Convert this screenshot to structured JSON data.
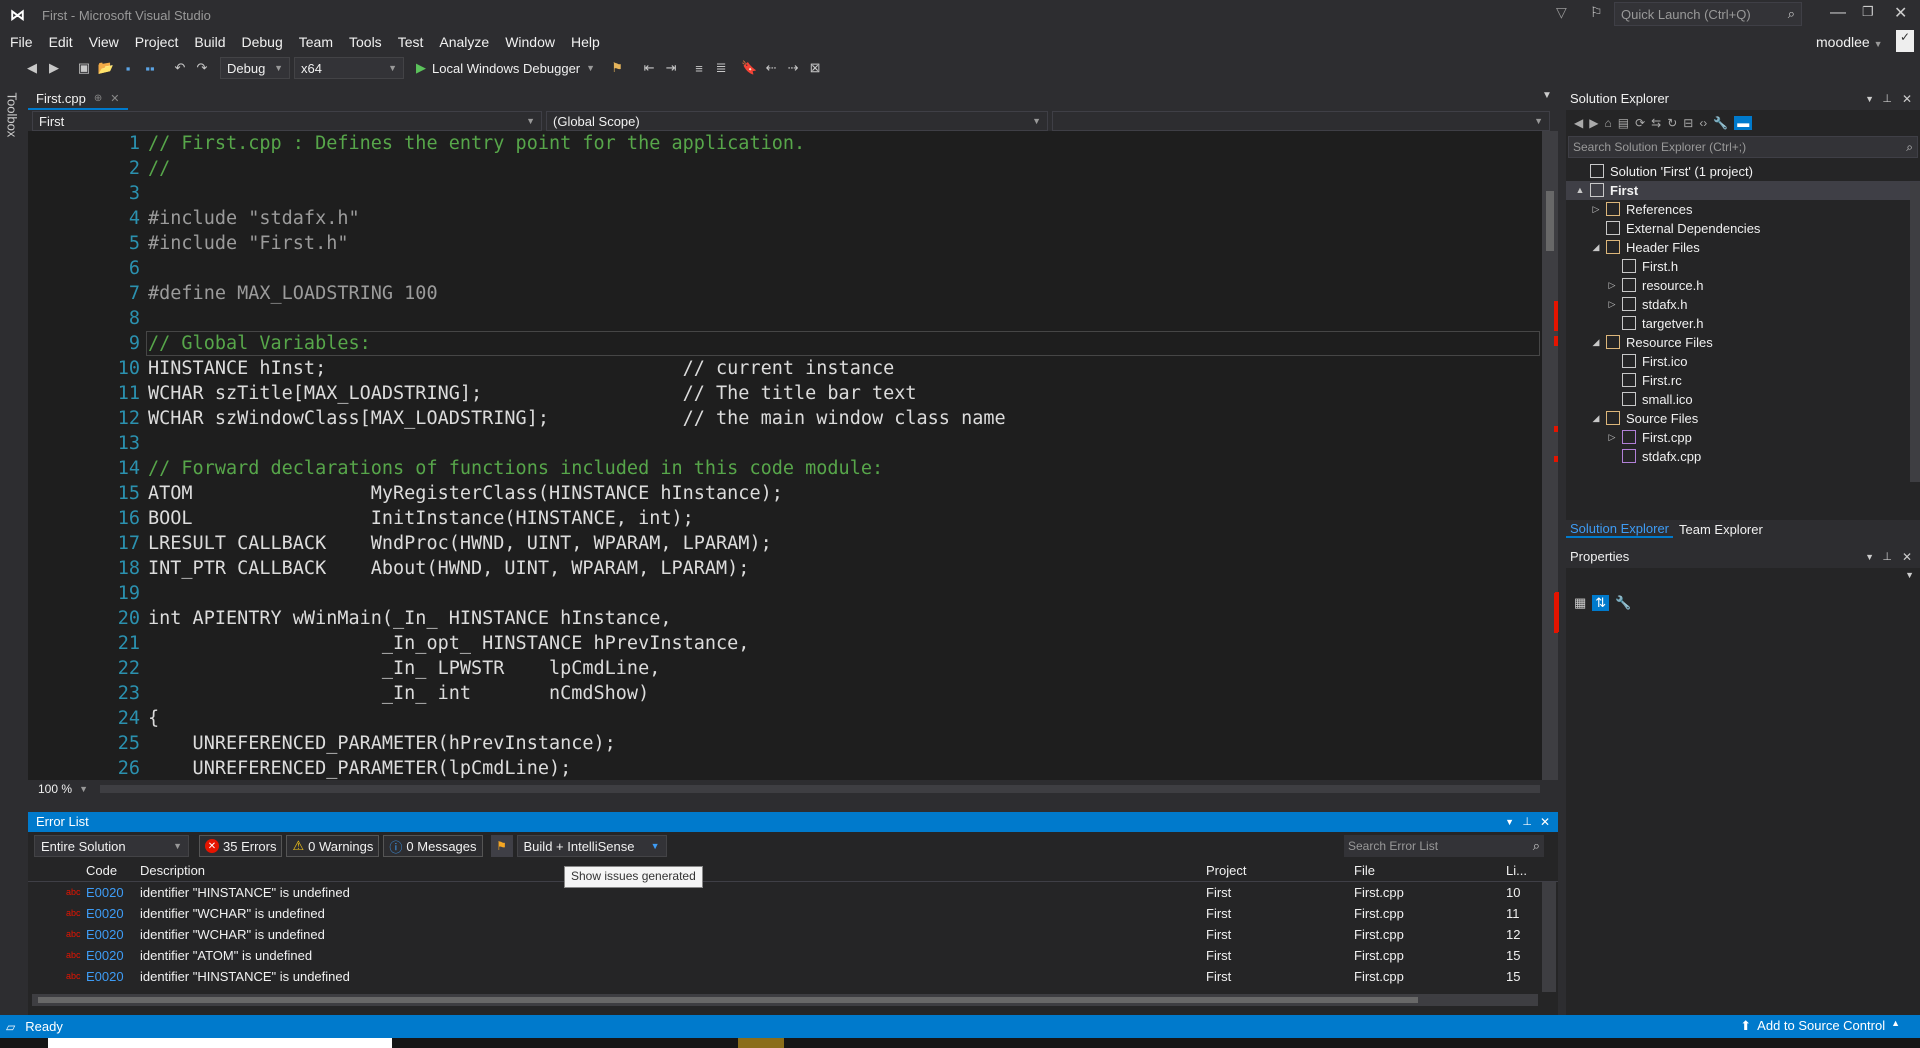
{
  "window": {
    "title": "First - Microsoft Visual Studio",
    "quick_launch_placeholder": "Quick Launch (Ctrl+Q)",
    "user": "moodlee"
  },
  "menu": [
    "File",
    "Edit",
    "View",
    "Project",
    "Build",
    "Debug",
    "Team",
    "Tools",
    "Test",
    "Analyze",
    "Window",
    "Help"
  ],
  "toolbar": {
    "config": "Debug",
    "platform": "x64",
    "debugger": "Local Windows Debugger"
  },
  "toolbox_label": "Toolbox",
  "editor": {
    "tab": "First.cpp",
    "nav_project": "First",
    "nav_scope": "(Global Scope)",
    "zoom": "100 %",
    "lines": [
      {
        "n": "1",
        "t": "// First.cpp : Defines the entry point for the application."
      },
      {
        "n": "2",
        "t": "//"
      },
      {
        "n": "3",
        "t": ""
      },
      {
        "n": "4",
        "t": "#include \"stdafx.h\""
      },
      {
        "n": "5",
        "t": "#include \"First.h\""
      },
      {
        "n": "6",
        "t": ""
      },
      {
        "n": "7",
        "t": "#define MAX_LOADSTRING 100"
      },
      {
        "n": "8",
        "t": ""
      },
      {
        "n": "9",
        "t": "// Global Variables:"
      },
      {
        "n": "10",
        "t": "HINSTANCE hInst;                                // current instance"
      },
      {
        "n": "11",
        "t": "WCHAR szTitle[MAX_LOADSTRING];                  // The title bar text"
      },
      {
        "n": "12",
        "t": "WCHAR szWindowClass[MAX_LOADSTRING];            // the main window class name"
      },
      {
        "n": "13",
        "t": ""
      },
      {
        "n": "14",
        "t": "// Forward declarations of functions included in this code module:"
      },
      {
        "n": "15",
        "t": "ATOM                MyRegisterClass(HINSTANCE hInstance);"
      },
      {
        "n": "16",
        "t": "BOOL                InitInstance(HINSTANCE, int);"
      },
      {
        "n": "17",
        "t": "LRESULT CALLBACK    WndProc(HWND, UINT, WPARAM, LPARAM);"
      },
      {
        "n": "18",
        "t": "INT_PTR CALLBACK    About(HWND, UINT, WPARAM, LPARAM);"
      },
      {
        "n": "19",
        "t": ""
      },
      {
        "n": "20",
        "t": "int APIENTRY wWinMain(_In_ HINSTANCE hInstance,"
      },
      {
        "n": "21",
        "t": "                     _In_opt_ HINSTANCE hPrevInstance,"
      },
      {
        "n": "22",
        "t": "                     _In_ LPWSTR    lpCmdLine,"
      },
      {
        "n": "23",
        "t": "                     _In_ int       nCmdShow)"
      },
      {
        "n": "24",
        "t": "{"
      },
      {
        "n": "25",
        "t": "    UNREFERENCED_PARAMETER(hPrevInstance);"
      },
      {
        "n": "26",
        "t": "    UNREFERENCED_PARAMETER(lpCmdLine);"
      }
    ]
  },
  "solution_explorer": {
    "title": "Solution Explorer",
    "search_placeholder": "Search Solution Explorer (Ctrl+;)",
    "items": [
      {
        "label": "Solution 'First' (1 project)",
        "level": 0,
        "exp": ""
      },
      {
        "label": "First",
        "level": 0,
        "exp": "▲"
      },
      {
        "label": "References",
        "level": 1,
        "exp": "▷"
      },
      {
        "label": "External Dependencies",
        "level": 1,
        "exp": ""
      },
      {
        "label": "Header Files",
        "level": 1,
        "exp": "◢"
      },
      {
        "label": "First.h",
        "level": 2,
        "exp": ""
      },
      {
        "label": "resource.h",
        "level": 2,
        "exp": "▷"
      },
      {
        "label": "stdafx.h",
        "level": 2,
        "exp": "▷"
      },
      {
        "label": "targetver.h",
        "level": 2,
        "exp": ""
      },
      {
        "label": "Resource Files",
        "level": 1,
        "exp": "◢"
      },
      {
        "label": "First.ico",
        "level": 2,
        "exp": ""
      },
      {
        "label": "First.rc",
        "level": 2,
        "exp": ""
      },
      {
        "label": "small.ico",
        "level": 2,
        "exp": ""
      },
      {
        "label": "Source Files",
        "level": 1,
        "exp": "◢"
      },
      {
        "label": "First.cpp",
        "level": 2,
        "exp": "▷"
      },
      {
        "label": "stdafx.cpp",
        "level": 2,
        "exp": ""
      }
    ],
    "tabs": [
      "Solution Explorer",
      "Team Explorer"
    ]
  },
  "properties": {
    "title": "Properties"
  },
  "error_list": {
    "title": "Error List",
    "scope": "Entire Solution",
    "errors": "35 Errors",
    "warnings": "0 Warnings",
    "messages": "0 Messages",
    "filter": "Build + IntelliSense",
    "tooltip": "Show issues generated",
    "search_placeholder": "Search Error List",
    "columns": [
      "Code",
      "Description",
      "Project",
      "File",
      "Li..."
    ],
    "rows": [
      {
        "code": "E0020",
        "desc": "identifier \"HINSTANCE\" is undefined",
        "project": "First",
        "file": "First.cpp",
        "line": "10"
      },
      {
        "code": "E0020",
        "desc": "identifier \"WCHAR\" is undefined",
        "project": "First",
        "file": "First.cpp",
        "line": "11"
      },
      {
        "code": "E0020",
        "desc": "identifier \"WCHAR\" is undefined",
        "project": "First",
        "file": "First.cpp",
        "line": "12"
      },
      {
        "code": "E0020",
        "desc": "identifier \"ATOM\" is undefined",
        "project": "First",
        "file": "First.cpp",
        "line": "15"
      },
      {
        "code": "E0020",
        "desc": "identifier \"HINSTANCE\" is undefined",
        "project": "First",
        "file": "First.cpp",
        "line": "15"
      }
    ]
  },
  "status": {
    "left": "Ready",
    "right": "Add to Source Control"
  }
}
